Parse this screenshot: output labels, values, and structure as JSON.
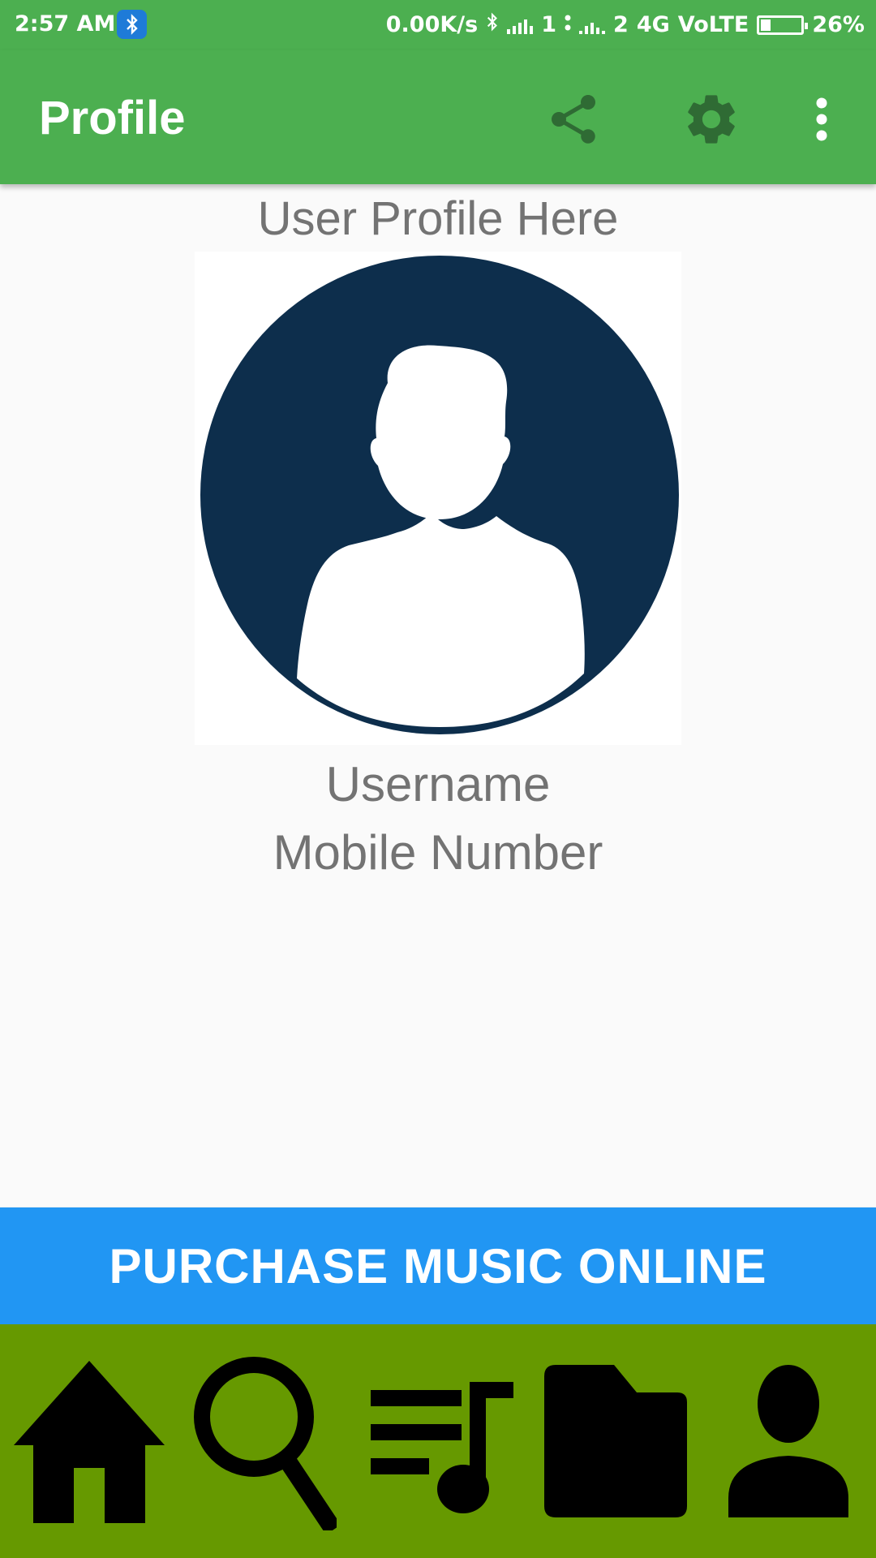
{
  "status_bar": {
    "time": "2:57 AM",
    "speed": "0.00K/s",
    "sim1": "1",
    "sim2": "2",
    "network": "4G",
    "volte": "VoLTE",
    "battery": "26%",
    "battery_level": 0.26,
    "icons": [
      "bluetooth-icon",
      "signal-icon",
      "battery-icon"
    ]
  },
  "app_bar": {
    "title": "Profile",
    "actions": [
      "share-icon",
      "settings-icon",
      "more-vert-icon"
    ]
  },
  "profile": {
    "section_title": "User Profile Here",
    "username": "Username",
    "mobile": "Mobile Number",
    "avatar_icon": "person-avatar-icon"
  },
  "purchase_button": {
    "label": "PURCHASE MUSIC ONLINE"
  },
  "bottom_nav": {
    "items": [
      "home-icon",
      "search-icon",
      "playlist-icon",
      "folder-icon",
      "person-icon"
    ]
  },
  "colors": {
    "primary": "#4caf50",
    "avatar_bg": "#0d2e4c",
    "button": "#2196f3",
    "nav_bg": "#669900",
    "text_secondary": "#737373"
  }
}
